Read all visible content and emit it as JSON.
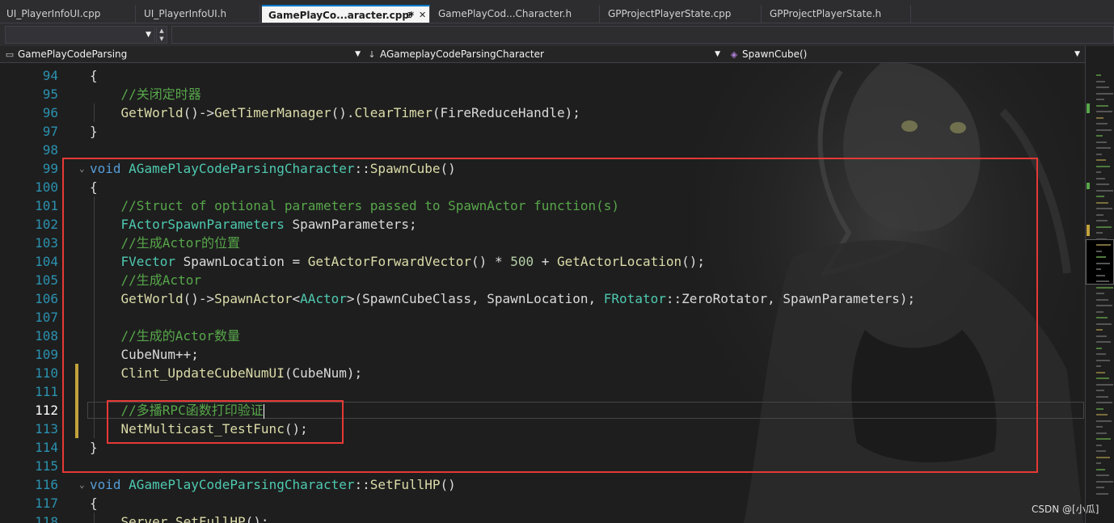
{
  "tabs": [
    {
      "label": "UI_PlayerInfoUI.cpp",
      "active": false
    },
    {
      "label": "UI_PlayerInfoUI.h",
      "active": false
    },
    {
      "label": "GamePlayCo...aracter.cpp*",
      "active": true,
      "pin": "⊕",
      "close": "✕"
    },
    {
      "label": "GamePlayCod...Character.h",
      "active": false
    },
    {
      "label": "GPProjectPlayerState.cpp",
      "active": false
    },
    {
      "label": "GPProjectPlayerState.h",
      "active": false
    }
  ],
  "toolbar": {
    "combo_value": ""
  },
  "navbar": {
    "project": "GamePlayCodeParsing",
    "class": "AGameplayCodeParsingCharacter",
    "method": "SpawnCube()",
    "project_icon": "project-icon",
    "class_icon": "class-arrow-icon",
    "method_icon": "method-cube-icon"
  },
  "code_lines": [
    {
      "n": "94",
      "tokens": [
        [
          "pl",
          "{"
        ]
      ]
    },
    {
      "n": "95",
      "tokens": [
        [
          "pl",
          "    "
        ],
        [
          "cm",
          "//关闭定时器"
        ]
      ]
    },
    {
      "n": "96",
      "tokens": [
        [
          "pl",
          "    "
        ],
        [
          "fn",
          "GetWorld"
        ],
        [
          "pl",
          "()->"
        ],
        [
          "fn",
          "GetTimerManager"
        ],
        [
          "pl",
          "()."
        ],
        [
          "fn",
          "ClearTimer"
        ],
        [
          "pl",
          "("
        ],
        [
          "id",
          "FireReduceHandle"
        ],
        [
          "pl",
          ");"
        ]
      ]
    },
    {
      "n": "97",
      "tokens": [
        [
          "pl",
          "}"
        ]
      ]
    },
    {
      "n": "98",
      "tokens": []
    },
    {
      "n": "99",
      "fold": true,
      "tokens": [
        [
          "kw",
          "void"
        ],
        [
          "pl",
          " "
        ],
        [
          "ty",
          "AGamePlayCodeParsingCharacter"
        ],
        [
          "pl",
          "::"
        ],
        [
          "fn",
          "SpawnCube"
        ],
        [
          "pl",
          "()"
        ]
      ]
    },
    {
      "n": "100",
      "tokens": [
        [
          "pl",
          "{"
        ]
      ]
    },
    {
      "n": "101",
      "tokens": [
        [
          "pl",
          "    "
        ],
        [
          "cm",
          "//Struct of optional parameters passed to SpawnActor function(s)"
        ]
      ]
    },
    {
      "n": "102",
      "tokens": [
        [
          "pl",
          "    "
        ],
        [
          "ty",
          "FActorSpawnParameters"
        ],
        [
          "pl",
          " "
        ],
        [
          "id",
          "SpawnParameters"
        ],
        [
          "pl",
          ";"
        ]
      ]
    },
    {
      "n": "103",
      "tokens": [
        [
          "pl",
          "    "
        ],
        [
          "cm",
          "//生成Actor的位置"
        ]
      ]
    },
    {
      "n": "104",
      "tokens": [
        [
          "pl",
          "    "
        ],
        [
          "ty",
          "FVector"
        ],
        [
          "pl",
          " "
        ],
        [
          "id",
          "SpawnLocation"
        ],
        [
          "pl",
          " = "
        ],
        [
          "fn",
          "GetActorForwardVector"
        ],
        [
          "pl",
          "() * "
        ],
        [
          "nm",
          "500"
        ],
        [
          "pl",
          " + "
        ],
        [
          "fn",
          "GetActorLocation"
        ],
        [
          "pl",
          "();"
        ]
      ]
    },
    {
      "n": "105",
      "tokens": [
        [
          "pl",
          "    "
        ],
        [
          "cm",
          "//生成Actor"
        ]
      ]
    },
    {
      "n": "106",
      "tokens": [
        [
          "pl",
          "    "
        ],
        [
          "fn",
          "GetWorld"
        ],
        [
          "pl",
          "()->"
        ],
        [
          "fn",
          "SpawnActor"
        ],
        [
          "pl",
          "<"
        ],
        [
          "ty",
          "AActor"
        ],
        [
          "pl",
          ">("
        ],
        [
          "id",
          "SpawnCubeClass"
        ],
        [
          "pl",
          ", "
        ],
        [
          "id",
          "SpawnLocation"
        ],
        [
          "pl",
          ", "
        ],
        [
          "ty",
          "FRotator"
        ],
        [
          "pl",
          "::"
        ],
        [
          "id",
          "ZeroRotator"
        ],
        [
          "pl",
          ", "
        ],
        [
          "id",
          "SpawnParameters"
        ],
        [
          "pl",
          ");"
        ]
      ]
    },
    {
      "n": "107",
      "tokens": []
    },
    {
      "n": "108",
      "tokens": [
        [
          "pl",
          "    "
        ],
        [
          "cm",
          "//生成的Actor数量"
        ]
      ]
    },
    {
      "n": "109",
      "tokens": [
        [
          "pl",
          "    "
        ],
        [
          "id",
          "CubeNum"
        ],
        [
          "pl",
          "++;"
        ]
      ]
    },
    {
      "n": "110",
      "changed": true,
      "tokens": [
        [
          "pl",
          "    "
        ],
        [
          "fn",
          "Clint_UpdateCubeNumUI"
        ],
        [
          "pl",
          "("
        ],
        [
          "id",
          "CubeNum"
        ],
        [
          "pl",
          ");"
        ]
      ]
    },
    {
      "n": "111",
      "changed": true,
      "tokens": []
    },
    {
      "n": "112",
      "changed": true,
      "current": true,
      "tokens": [
        [
          "pl",
          "    "
        ],
        [
          "cm",
          "//多播RPC函数打印验证"
        ]
      ]
    },
    {
      "n": "113",
      "changed": true,
      "tokens": [
        [
          "pl",
          "    "
        ],
        [
          "fn",
          "NetMulticast_TestFunc"
        ],
        [
          "pl",
          "();"
        ]
      ]
    },
    {
      "n": "114",
      "tokens": [
        [
          "pl",
          "}"
        ]
      ]
    },
    {
      "n": "115",
      "tokens": []
    },
    {
      "n": "116",
      "fold": true,
      "tokens": [
        [
          "kw",
          "void"
        ],
        [
          "pl",
          " "
        ],
        [
          "ty",
          "AGamePlayCodeParsingCharacter"
        ],
        [
          "pl",
          "::"
        ],
        [
          "fn",
          "SetFullHP"
        ],
        [
          "pl",
          "()"
        ]
      ]
    },
    {
      "n": "117",
      "tokens": [
        [
          "pl",
          "{"
        ]
      ]
    },
    {
      "n": "118",
      "tokens": [
        [
          "pl",
          "    "
        ],
        [
          "fn",
          "Server_SetFullHP"
        ],
        [
          "pl",
          "();"
        ]
      ]
    }
  ],
  "watermark": "CSDN @[小瓜]"
}
